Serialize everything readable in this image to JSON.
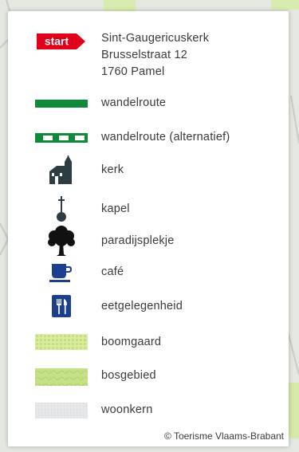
{
  "start": {
    "badge": "start",
    "address_lines": [
      "Sint-Gaugericuskerk",
      "Brusselstraat 12",
      "1760 Pamel"
    ]
  },
  "legend": [
    {
      "key": "walk",
      "label": "wandelroute",
      "icon": "route-line"
    },
    {
      "key": "walk-alt",
      "label": "wandelroute (alternatief)",
      "icon": "route-dashed"
    },
    {
      "key": "church",
      "label": "kerk",
      "icon": "church-icon"
    },
    {
      "key": "chapel",
      "label": "kapel",
      "icon": "chapel-icon"
    },
    {
      "key": "paradise",
      "label": "paradijsplekje",
      "icon": "tree-icon"
    },
    {
      "key": "cafe",
      "label": "café",
      "icon": "cup-icon"
    },
    {
      "key": "eat",
      "label": "eetgelegenheid",
      "icon": "cutlery-icon"
    },
    {
      "key": "orchard",
      "label": "boomgaard",
      "icon": "orchard-swatch"
    },
    {
      "key": "forest",
      "label": "bosgebied",
      "icon": "forest-swatch"
    },
    {
      "key": "residential",
      "label": "woonkern",
      "icon": "residential-swatch"
    }
  ],
  "copyright": "© Toerisme Vlaams-Brabant",
  "colors": {
    "start_red": "#e1001a",
    "route_green": "#0f8a3a",
    "icon_dark": "#2e3c44",
    "icon_blue": "#1d3f8f",
    "orchard": "#d9ec9e",
    "forest": "#c6e08a",
    "residential": "#e6e8ea"
  }
}
